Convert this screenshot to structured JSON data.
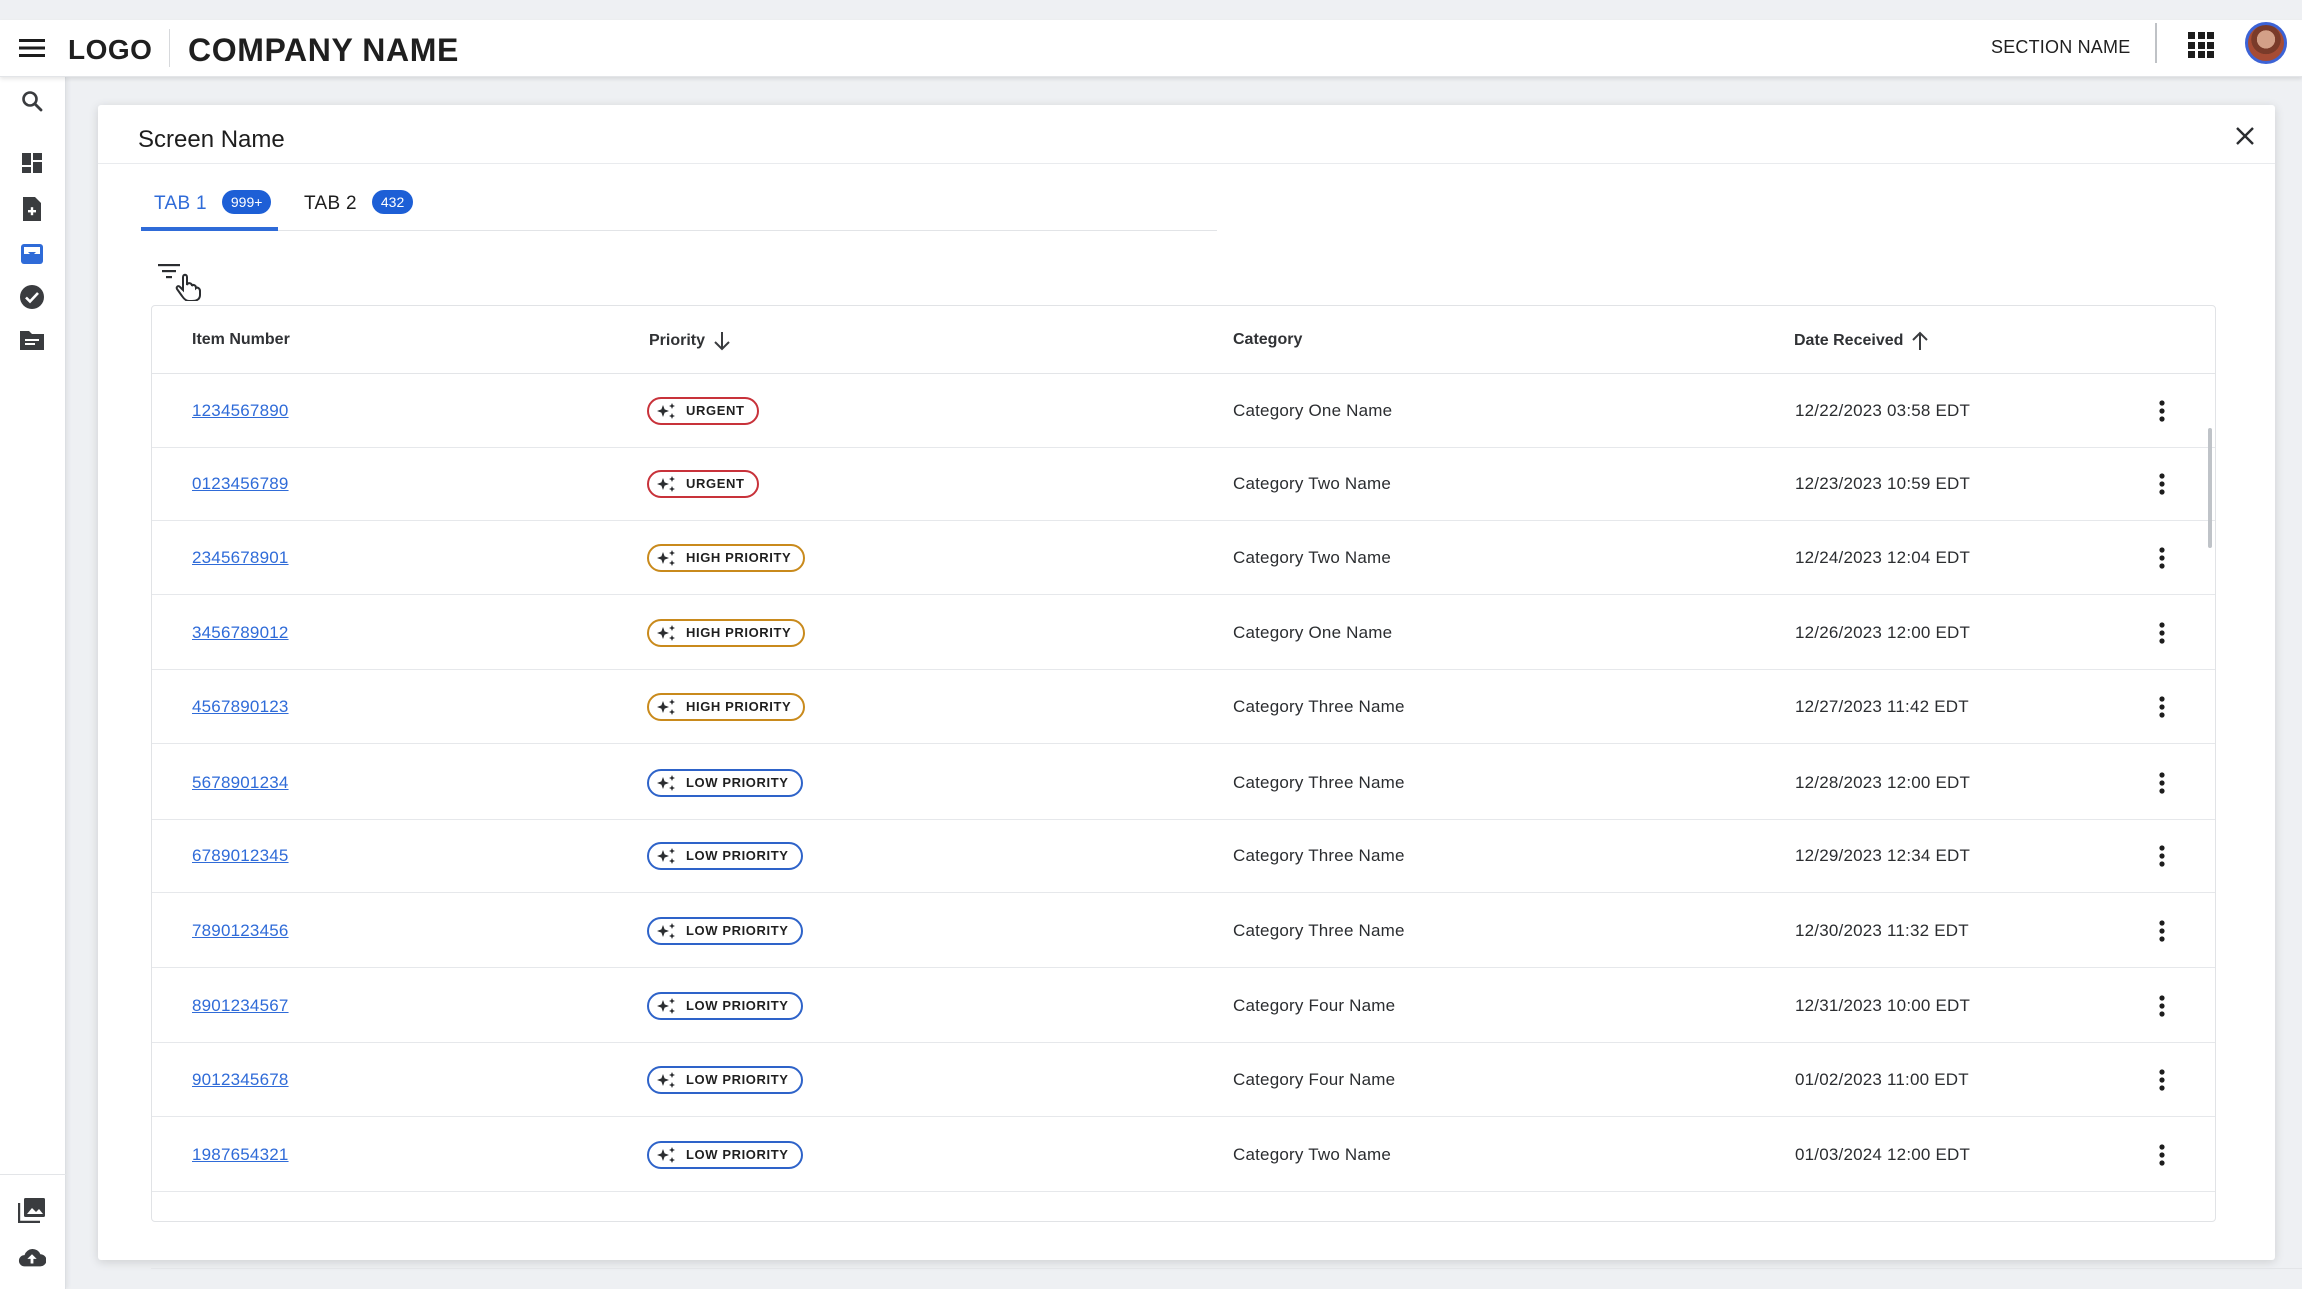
{
  "topbar": {
    "logo": "LOGO",
    "company": "COMPANY NAME",
    "section": "SECTION NAME"
  },
  "rail": {
    "icons": [
      "search-icon",
      "dashboard-icon",
      "add-document-icon",
      "inbox-icon",
      "check-circle-icon",
      "folder-icon",
      "photo-library-icon",
      "cloud-upload-icon"
    ]
  },
  "screen": {
    "title": "Screen Name",
    "tabs": [
      {
        "label": "TAB 1",
        "count": "999+"
      },
      {
        "label": "TAB 2",
        "count": "432"
      }
    ]
  },
  "table": {
    "headers": {
      "item": "Item Number",
      "priority": "Priority",
      "category": "Category",
      "date": "Date Received"
    },
    "rows": [
      {
        "item": "1234567890",
        "priority": "URGENT",
        "level": "urgent",
        "category": "Category One Name",
        "date": "12/22/2023 03:58 EDT"
      },
      {
        "item": "0123456789",
        "priority": "URGENT",
        "level": "urgent",
        "category": "Category Two Name",
        "date": "12/23/2023 10:59 EDT"
      },
      {
        "item": "2345678901",
        "priority": "HIGH PRIORITY",
        "level": "high",
        "category": "Category Two Name",
        "date": "12/24/2023 12:04 EDT"
      },
      {
        "item": "3456789012",
        "priority": "HIGH PRIORITY",
        "level": "high",
        "category": "Category One Name",
        "date": "12/26/2023 12:00 EDT"
      },
      {
        "item": "4567890123",
        "priority": "HIGH PRIORITY",
        "level": "high",
        "category": "Category Three Name",
        "date": "12/27/2023 11:42 EDT"
      },
      {
        "item": "5678901234",
        "priority": "LOW PRIORITY",
        "level": "low",
        "category": "Category Three Name",
        "date": "12/28/2023 12:00 EDT"
      },
      {
        "item": "6789012345",
        "priority": "LOW PRIORITY",
        "level": "low",
        "category": "Category Three Name",
        "date": "12/29/2023 12:34 EDT"
      },
      {
        "item": "7890123456",
        "priority": "LOW PRIORITY",
        "level": "low",
        "category": "Category Three Name",
        "date": "12/30/2023 11:32 EDT"
      },
      {
        "item": "8901234567",
        "priority": "LOW PRIORITY",
        "level": "low",
        "category": "Category Four Name",
        "date": "12/31/2023 10:00 EDT"
      },
      {
        "item": "9012345678",
        "priority": "LOW PRIORITY",
        "level": "low",
        "category": "Category Four Name",
        "date": "01/02/2023 11:00 EDT"
      },
      {
        "item": "1987654321",
        "priority": "LOW PRIORITY",
        "level": "low",
        "category": "Category Two Name",
        "date": "01/03/2024 12:00 EDT"
      }
    ]
  },
  "colors": {
    "accent": "#2f6bd8",
    "urgent": "#c8323a",
    "high": "#c98a1c",
    "low": "#2e63c9"
  }
}
